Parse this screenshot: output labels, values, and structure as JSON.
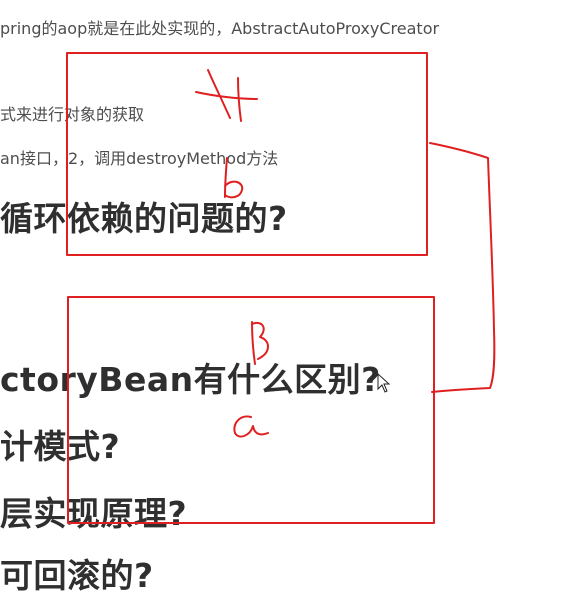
{
  "content": {
    "line1": "pring的aop就是在此处实现的，AbstractAutoProxyCreator",
    "line2": "式来进行对象的获取",
    "line3": "an接口，2，调用destroyMethod方法",
    "heading1": "循环依赖的问题的?",
    "heading2": "ctoryBean有什么区别?",
    "heading3": "计模式?",
    "heading4": "层实现原理?",
    "heading5": "可回滚的?"
  },
  "annotations": {
    "color": "#e02020",
    "box_top_labels": [
      "A",
      "b"
    ],
    "box_bottom_labels": [
      "B",
      "a"
    ]
  }
}
